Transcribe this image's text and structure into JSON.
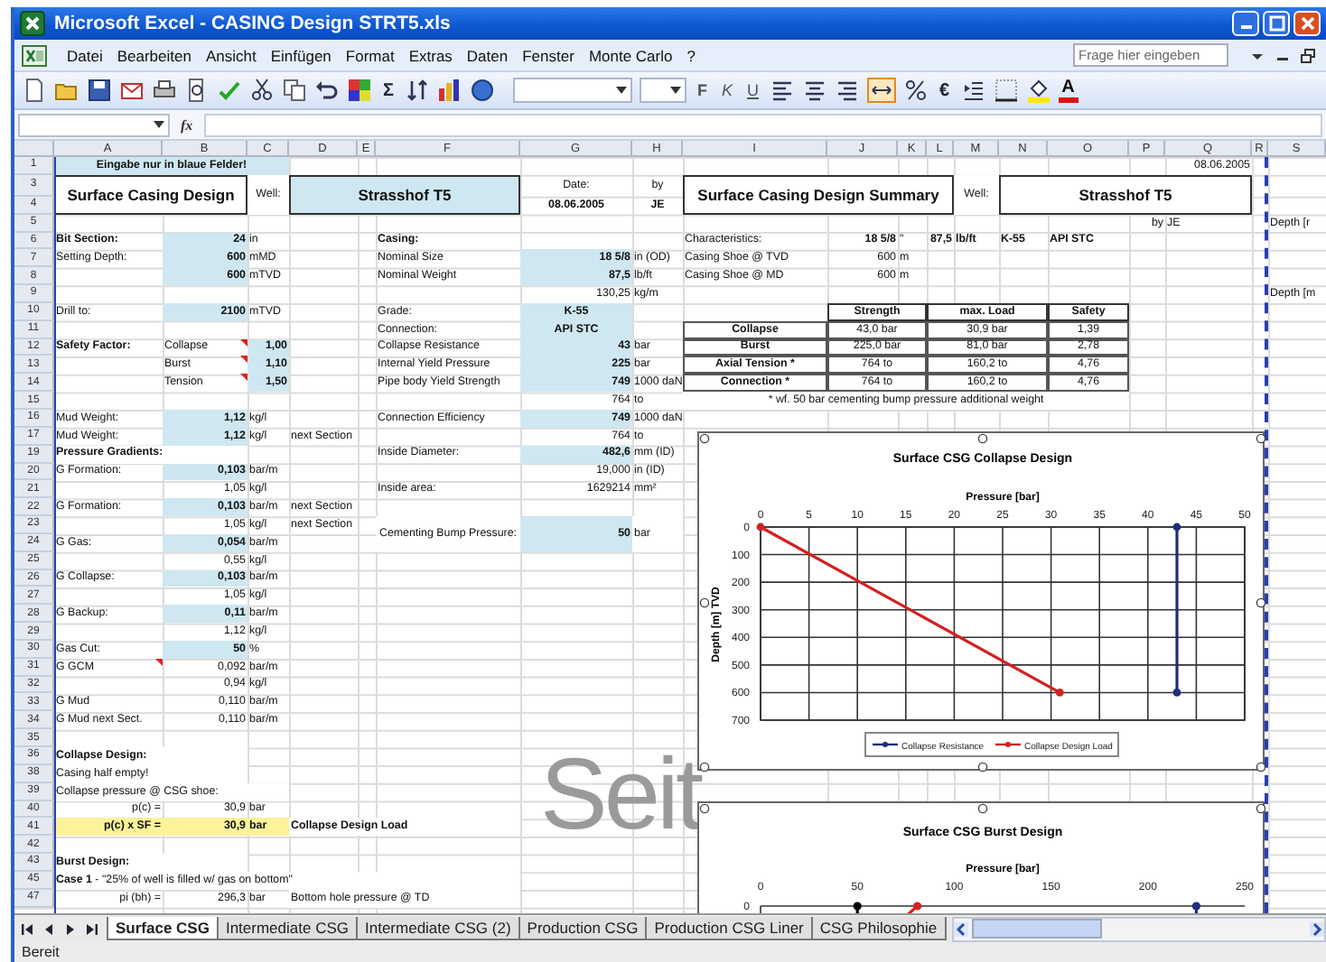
{
  "window": {
    "title": "Microsoft Excel - CASING Design STRT5.xls"
  },
  "menu": {
    "items": [
      "Datei",
      "Bearbeiten",
      "Ansicht",
      "Einfügen",
      "Format",
      "Extras",
      "Daten",
      "Fenster",
      "Monte Carlo",
      "?"
    ],
    "help_field": {
      "placeholder": "Frage hier eingeben"
    }
  },
  "toolbar": {
    "sum": "Σ",
    "format_buttons": [
      {
        "text": "F",
        "kind": "bold"
      },
      {
        "text": "K",
        "kind": "italic"
      },
      {
        "text": "U",
        "kind": "underline"
      }
    ],
    "currency": "€",
    "font_color": "A"
  },
  "formula_bar": {
    "function_label": "fx"
  },
  "sheet": {
    "columns": [
      "A",
      "B",
      "C",
      "D",
      "E",
      "F",
      "G",
      "H",
      "I",
      "J",
      "K",
      "L",
      "M",
      "N",
      "O",
      "P",
      "Q",
      "R",
      "S"
    ],
    "rows": [
      {
        "n": "1",
        "cells": [
          {
            "text": "Eingabe nur in blaue Felder!",
            "kind": "entry",
            "colspan": 3
          },
          "",
          "",
          "",
          "",
          "",
          "",
          "",
          "",
          "",
          "",
          "",
          "",
          "",
          {
            "text": "08.06.2005",
            "kind": "value"
          }
        ]
      },
      {
        "n": "3",
        "cells": [
          {
            "text": "Surface Casing Design",
            "kind": "title",
            "colspan": 2,
            "rowspan": 2
          },
          {
            "text": "Well:",
            "kind": "center",
            "rowspan": 2
          },
          {
            "text": "Strasshof T5",
            "kind": "banner",
            "colspan": 3,
            "rowspan": 2
          },
          {
            "text": "Date:",
            "kind": "center"
          },
          {
            "text": "by",
            "kind": "center"
          },
          {
            "text": "Surface Casing Design Summary",
            "kind": "title",
            "colspan": 4,
            "rowspan": 2
          },
          {
            "text": "Well:",
            "kind": "center",
            "rowspan": 2
          },
          {
            "text": "Strasshof T5",
            "kind": "title",
            "colspan": 4,
            "rowspan": 2
          }
        ]
      },
      {
        "n": "4",
        "cells": [
          {
            "text": "08.06.2005",
            "kind": "bold"
          },
          {
            "text": "JE",
            "kind": "bold"
          }
        ]
      },
      {
        "n": "5",
        "cells": [
          "",
          "",
          "",
          "",
          "",
          "",
          "",
          "",
          "",
          "",
          "",
          "",
          "",
          "",
          "",
          {
            "text": "by",
            "kind": "value"
          },
          {
            "text": "JE",
            "kind": "label"
          },
          "",
          {
            "text": "Depth [r",
            "kind": "label"
          }
        ]
      },
      {
        "n": "6",
        "cells": [
          {
            "text": "Bit Section:",
            "kind": "heading"
          },
          {
            "text": "24",
            "kind": "input"
          },
          {
            "text": "in",
            "kind": "label"
          },
          "",
          "",
          {
            "text": "Casing:",
            "kind": "heading"
          },
          "",
          "",
          {
            "text": "Characteristics:",
            "kind": "label"
          },
          {
            "text": "18 5/8",
            "kind": "strong"
          },
          {
            "text": "\"",
            "kind": "label"
          },
          {
            "text": "87,5",
            "kind": "strong"
          },
          {
            "text": "lb/ft",
            "kind": "heading"
          },
          {
            "text": "K-55",
            "kind": "heading"
          },
          {
            "text": "API STC",
            "kind": "heading"
          }
        ]
      },
      {
        "n": "7",
        "cells": [
          {
            "text": "Setting Depth:",
            "kind": "label"
          },
          {
            "text": "600",
            "kind": "input"
          },
          {
            "text": "mMD",
            "kind": "label"
          },
          "",
          "",
          {
            "text": "Nominal Size",
            "kind": "label"
          },
          {
            "text": "18 5/8",
            "kind": "input"
          },
          {
            "text": "in (OD)",
            "kind": "label"
          },
          {
            "text": "Casing Shoe @ TVD",
            "kind": "label"
          },
          {
            "text": "600",
            "kind": "value"
          },
          {
            "text": "m",
            "kind": "label"
          }
        ]
      },
      {
        "n": "8",
        "cells": [
          "",
          {
            "text": "600",
            "kind": "input"
          },
          {
            "text": "mTVD",
            "kind": "label"
          },
          "",
          "",
          {
            "text": "Nominal Weight",
            "kind": "label"
          },
          {
            "text": "87,5",
            "kind": "input"
          },
          {
            "text": "lb/ft",
            "kind": "label"
          },
          {
            "text": "Casing Shoe @ MD",
            "kind": "label"
          },
          {
            "text": "600",
            "kind": "value"
          },
          {
            "text": "m",
            "kind": "label"
          }
        ]
      },
      {
        "n": "9",
        "cells": [
          "",
          "",
          "",
          "",
          "",
          "",
          {
            "text": "130,25",
            "kind": "value"
          },
          {
            "text": "kg/m",
            "kind": "label"
          },
          "",
          "",
          "",
          "",
          "",
          "",
          "",
          "",
          "",
          "",
          {
            "text": "Depth [m",
            "kind": "label"
          }
        ]
      },
      {
        "n": "10",
        "cells": [
          {
            "text": "Drill to:",
            "kind": "label"
          },
          {
            "text": "2100",
            "kind": "input"
          },
          {
            "text": "mTVD",
            "kind": "label"
          },
          "",
          "",
          {
            "text": "Grade:",
            "kind": "label"
          },
          {
            "text": "K-55",
            "kind": "entry"
          },
          "",
          "",
          {
            "text": "Strength",
            "kind": "head",
            "colspan": 2
          },
          {
            "text": "max. Load",
            "kind": "head",
            "colspan": 3
          },
          {
            "text": "Safety",
            "kind": "head"
          }
        ]
      },
      {
        "n": "11",
        "cells": [
          "",
          "",
          "",
          "",
          "",
          {
            "text": "Connection:",
            "kind": "label"
          },
          {
            "text": "API STC",
            "kind": "entry"
          },
          "",
          {
            "text": "Collapse",
            "kind": "cellbold"
          },
          {
            "text": "43,0 bar",
            "kind": "cell",
            "colspan": 2
          },
          {
            "text": "30,9 bar",
            "kind": "cell",
            "colspan": 3
          },
          {
            "text": "1,39",
            "kind": "cell"
          }
        ]
      },
      {
        "n": "12",
        "cells": [
          {
            "text": "Safety Factor:",
            "kind": "heading"
          },
          {
            "text": "Collapse",
            "kind": "label",
            "comment": true
          },
          {
            "text": "1,00",
            "kind": "input"
          },
          "",
          "",
          {
            "text": "Collapse Resistance",
            "kind": "label"
          },
          {
            "text": "43",
            "kind": "input"
          },
          {
            "text": "bar",
            "kind": "label"
          },
          {
            "text": "Burst",
            "kind": "cellbold"
          },
          {
            "text": "225,0 bar",
            "kind": "cell",
            "colspan": 2
          },
          {
            "text": "81,0 bar",
            "kind": "cell",
            "colspan": 3
          },
          {
            "text": "2,78",
            "kind": "cell"
          }
        ]
      },
      {
        "n": "13",
        "cells": [
          "",
          {
            "text": "Burst",
            "kind": "label",
            "comment": true
          },
          {
            "text": "1,10",
            "kind": "input"
          },
          "",
          "",
          {
            "text": "Internal Yield Pressure",
            "kind": "label"
          },
          {
            "text": "225",
            "kind": "input"
          },
          {
            "text": "bar",
            "kind": "label"
          },
          {
            "text": "Axial Tension *",
            "kind": "cellbold"
          },
          {
            "text": "764 to",
            "kind": "cell",
            "colspan": 2
          },
          {
            "text": "160,2 to",
            "kind": "cell",
            "colspan": 3
          },
          {
            "text": "4,76",
            "kind": "cell"
          }
        ]
      },
      {
        "n": "14",
        "cells": [
          "",
          {
            "text": "Tension",
            "kind": "label",
            "comment": true
          },
          {
            "text": "1,50",
            "kind": "input"
          },
          "",
          "",
          {
            "text": "Pipe body Yield Strength",
            "kind": "label"
          },
          {
            "text": "749",
            "kind": "input"
          },
          {
            "text": "1000 daN",
            "kind": "label"
          },
          {
            "text": "Connection *",
            "kind": "cellbold"
          },
          {
            "text": "764 to",
            "kind": "cell",
            "colspan": 2
          },
          {
            "text": "160,2 to",
            "kind": "cell",
            "colspan": 3
          },
          {
            "text": "4,76",
            "kind": "cell"
          }
        ]
      },
      {
        "n": "15",
        "cells": [
          "",
          "",
          "",
          "",
          "",
          "",
          {
            "text": "764",
            "kind": "value"
          },
          {
            "text": "to",
            "kind": "label"
          },
          {
            "text": "* wf. 50 bar cementing bump pressure additional weight",
            "kind": "note",
            "colspan": 7
          }
        ]
      },
      {
        "n": "16",
        "cells": [
          {
            "text": "Mud Weight:",
            "kind": "label"
          },
          {
            "text": "1,12",
            "kind": "input"
          },
          {
            "text": "kg/l",
            "kind": "label"
          },
          "",
          "",
          {
            "text": "Connection Efficiency",
            "kind": "label"
          },
          {
            "text": "749",
            "kind": "input"
          },
          {
            "text": "1000 daN",
            "kind": "label"
          }
        ]
      },
      {
        "n": "17",
        "cells": [
          {
            "text": "Mud Weight:",
            "kind": "label"
          },
          {
            "text": "1,12",
            "kind": "input"
          },
          {
            "text": "kg/l",
            "kind": "label"
          },
          {
            "text": "next Section",
            "kind": "label"
          },
          "",
          "",
          {
            "text": "764",
            "kind": "value"
          },
          {
            "text": "to",
            "kind": "label"
          }
        ]
      },
      {
        "n": "19",
        "cells": [
          {
            "text": "Pressure Gradients:",
            "kind": "heading",
            "colspan": 2
          },
          "",
          "",
          "",
          {
            "text": "Inside Diameter:",
            "kind": "label"
          },
          {
            "text": "482,6",
            "kind": "input"
          },
          {
            "text": "mm (ID)",
            "kind": "label"
          }
        ]
      },
      {
        "n": "20",
        "cells": [
          {
            "text": "G Formation:",
            "kind": "label"
          },
          {
            "text": "0,103",
            "kind": "input"
          },
          {
            "text": "bar/m",
            "kind": "label"
          },
          "",
          "",
          "",
          {
            "text": "19,000",
            "kind": "value"
          },
          {
            "text": "in (ID)",
            "kind": "label"
          }
        ]
      },
      {
        "n": "21",
        "cells": [
          "",
          {
            "text": "1,05",
            "kind": "value"
          },
          {
            "text": "kg/l",
            "kind": "label"
          },
          "",
          "",
          {
            "text": "Inside area:",
            "kind": "label"
          },
          {
            "text": "1629214",
            "kind": "value"
          },
          {
            "text": "mm²",
            "kind": "label"
          }
        ]
      },
      {
        "n": "22",
        "cells": [
          {
            "text": "G Formation:",
            "kind": "label"
          },
          {
            "text": "0,103",
            "kind": "input"
          },
          {
            "text": "bar/m",
            "kind": "label"
          },
          {
            "text": "next Section",
            "kind": "label"
          }
        ]
      },
      {
        "n": "23",
        "cells": [
          "",
          {
            "text": "1,05",
            "kind": "value"
          },
          {
            "text": "kg/l",
            "kind": "label"
          },
          {
            "text": "next Section",
            "kind": "label"
          },
          "",
          {
            "text": "Cementing Bump Pressure:",
            "kind": "wrap",
            "rowspan": 2
          },
          {
            "text": "50",
            "kind": "input",
            "rowspan": 2
          },
          {
            "text": "bar",
            "kind": "label",
            "rowspan": 2
          }
        ]
      },
      {
        "n": "24",
        "cells": [
          {
            "text": "G Gas:",
            "kind": "label"
          },
          {
            "text": "0,054",
            "kind": "input"
          },
          {
            "text": "bar/m",
            "kind": "label"
          }
        ]
      },
      {
        "n": "25",
        "cells": [
          "",
          {
            "text": "0,55",
            "kind": "value"
          },
          {
            "text": "kg/l",
            "kind": "label"
          }
        ]
      },
      {
        "n": "26",
        "cells": [
          {
            "text": "G Collapse:",
            "kind": "label"
          },
          {
            "text": "0,103",
            "kind": "input"
          },
          {
            "text": "bar/m",
            "kind": "label"
          }
        ]
      },
      {
        "n": "27",
        "cells": [
          "",
          {
            "text": "1,05",
            "kind": "value"
          },
          {
            "text": "kg/l",
            "kind": "label"
          }
        ]
      },
      {
        "n": "28",
        "cells": [
          {
            "text": "G Backup:",
            "kind": "label"
          },
          {
            "text": "0,11",
            "kind": "input"
          },
          {
            "text": "bar/m",
            "kind": "label"
          }
        ]
      },
      {
        "n": "29",
        "cells": [
          "",
          {
            "text": "1,12",
            "kind": "value"
          },
          {
            "text": "kg/l",
            "kind": "label"
          }
        ]
      },
      {
        "n": "30",
        "cells": [
          {
            "text": "Gas Cut:",
            "kind": "label"
          },
          {
            "text": "50",
            "kind": "input"
          },
          {
            "text": "%",
            "kind": "label"
          }
        ]
      },
      {
        "n": "31",
        "cells": [
          {
            "text": "G GCM",
            "kind": "label",
            "comment": true
          },
          {
            "text": "0,092",
            "kind": "value"
          },
          {
            "text": "bar/m",
            "kind": "label"
          }
        ]
      },
      {
        "n": "32",
        "cells": [
          "",
          {
            "text": "0,94",
            "kind": "value"
          },
          {
            "text": "kg/l",
            "kind": "label"
          }
        ]
      },
      {
        "n": "33",
        "cells": [
          {
            "text": "G Mud",
            "kind": "label"
          },
          {
            "text": "0,110",
            "kind": "value"
          },
          {
            "text": "bar/m",
            "kind": "label"
          }
        ]
      },
      {
        "n": "34",
        "cells": [
          {
            "text": "G Mud next Sect.",
            "kind": "label"
          },
          {
            "text": "0,110",
            "kind": "value"
          },
          {
            "text": "bar/m",
            "kind": "label"
          }
        ]
      },
      {
        "n": "35",
        "cells": []
      },
      {
        "n": "36",
        "cells": [
          {
            "text": "Collapse Design:",
            "kind": "heading",
            "colspan": 2
          }
        ]
      },
      {
        "n": "38",
        "cells": [
          {
            "text": "Casing half empty!",
            "kind": "label",
            "colspan": 2
          }
        ]
      },
      {
        "n": "39",
        "cells": [
          {
            "text": "Collapse pressure @ CSG shoe:",
            "kind": "label",
            "colspan": 3
          }
        ]
      },
      {
        "n": "40",
        "cells": [
          {
            "text": "p(c) =",
            "kind": "value"
          },
          {
            "text": "30,9",
            "kind": "value"
          },
          {
            "text": "bar",
            "kind": "label"
          }
        ]
      },
      {
        "n": "41",
        "highlighted": true,
        "cells": [
          {
            "text": "p(c) x SF =",
            "kind": "strong"
          },
          {
            "text": "30,9",
            "kind": "strong"
          },
          {
            "text": "bar",
            "kind": "heading"
          },
          {
            "text": "Collapse Design Load",
            "kind": "heading",
            "colspan": 3
          }
        ]
      },
      {
        "n": "42",
        "cells": []
      },
      {
        "n": "43",
        "cells": [
          {
            "text": "Burst Design:",
            "kind": "heading",
            "colspan": 2
          }
        ]
      },
      {
        "n": "45",
        "cells": [
          {
            "text": "**Case 1** - \"25% of well is filled w/ gas on bottom\"",
            "kind": "label",
            "colspan": 6
          }
        ]
      },
      {
        "n": "47",
        "cells": [
          {
            "text": "pi (bh) =",
            "kind": "value"
          },
          {
            "text": "296,3",
            "kind": "value"
          },
          {
            "text": "bar",
            "kind": "label"
          },
          {
            "text": "Bottom hole pressure @ TD",
            "kind": "label",
            "colspan": 3
          }
        ]
      }
    ],
    "watermark": "Seit",
    "charts": [
      {
        "chart_data": {
          "type": "line",
          "title": "Surface CSG Collapse Design",
          "xlabel": "Pressure [bar]",
          "ylabel": "Depth [m] TVD",
          "xlim": [
            0,
            50
          ],
          "ylim": [
            700,
            0
          ],
          "xticks": [
            0,
            5,
            10,
            15,
            20,
            25,
            30,
            35,
            40,
            45,
            50
          ],
          "yticks": [
            0,
            100,
            200,
            300,
            400,
            500,
            600,
            700
          ],
          "grid": true,
          "legend": true,
          "series": [
            {
              "name": "Collapse Resistance",
              "color": "#1f2d7a",
              "marker": "circle",
              "x": [
                43,
                43
              ],
              "values": [
                0,
                600
              ]
            },
            {
              "name": "Collapse Design Load",
              "color": "#d42020",
              "marker": "circle",
              "x": [
                0,
                30.9
              ],
              "values": [
                0,
                600
              ]
            }
          ]
        }
      },
      {
        "title": "Surface CSG Burst Design",
        "xlabel": "Pressure [bar]",
        "x_tick_labels": [
          "0",
          "50",
          "100",
          "150",
          "200",
          "250"
        ],
        "y_tick_labels": [
          "0"
        ]
      }
    ]
  },
  "sheet_tabs": [
    {
      "label": "Surface CSG",
      "selected": true
    },
    {
      "label": "Intermediate CSG",
      "selected": false
    },
    {
      "label": "Intermediate CSG (2)",
      "selected": false
    },
    {
      "label": "Production CSG",
      "selected": false
    },
    {
      "label": "Production CSG Liner",
      "selected": false
    },
    {
      "label": "CSG Philosophie",
      "selected": false
    }
  ],
  "status_bar": "Bereit"
}
